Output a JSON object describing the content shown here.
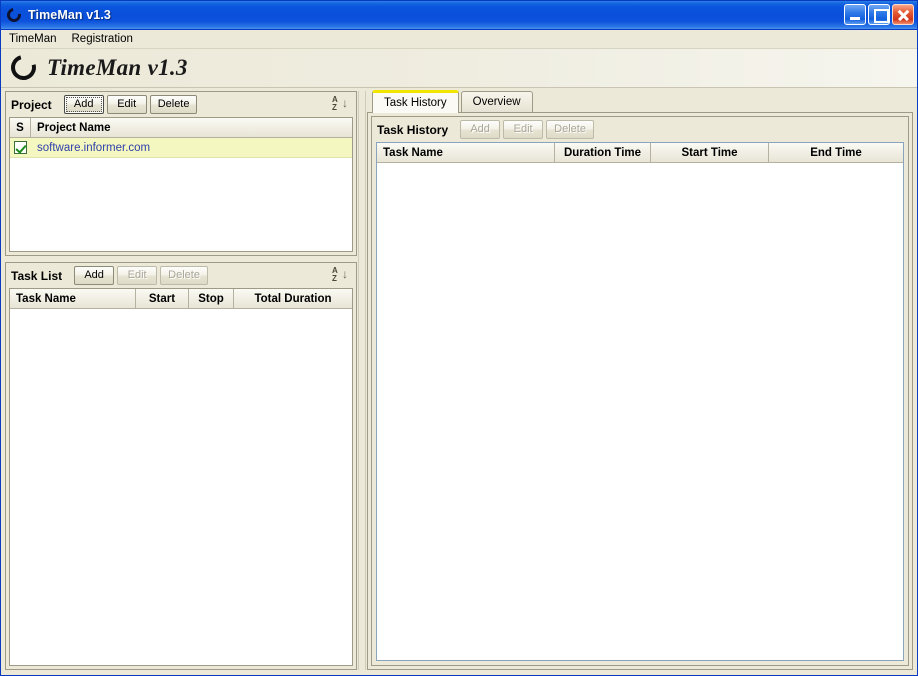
{
  "window": {
    "title": "TimeMan v1.3",
    "icon": "ring-icon",
    "controls": {
      "minimize": "minimize-button",
      "maximize": "maximize-button",
      "close": "close-button"
    }
  },
  "menubar": {
    "items": [
      {
        "label": "TimeMan"
      },
      {
        "label": "Registration"
      }
    ]
  },
  "branding": {
    "logo_icon": "ring-logo",
    "title": "TimeMan v1.3"
  },
  "project_panel": {
    "title": "Project",
    "buttons": [
      {
        "label": "Add",
        "state": "focused"
      },
      {
        "label": "Edit",
        "state": "enabled"
      },
      {
        "label": "Delete",
        "state": "enabled"
      }
    ],
    "sort_icon": "sort-az-descending-icon",
    "columns": [
      {
        "label": "S",
        "align": "center"
      },
      {
        "label": "Project Name",
        "align": "left"
      }
    ],
    "rows": [
      {
        "selected": true,
        "checked": true,
        "name": "software.informer.com"
      }
    ]
  },
  "task_list_panel": {
    "title": "Task List",
    "buttons": [
      {
        "label": "Add",
        "state": "enabled"
      },
      {
        "label": "Edit",
        "state": "disabled"
      },
      {
        "label": "Delete",
        "state": "disabled"
      }
    ],
    "sort_icon": "sort-az-descending-icon",
    "columns": [
      {
        "label": "Task Name",
        "align": "left"
      },
      {
        "label": "Start",
        "align": "center"
      },
      {
        "label": "Stop",
        "align": "center"
      },
      {
        "label": "Total Duration",
        "align": "center"
      }
    ],
    "rows": []
  },
  "tabs": [
    {
      "label": "Task History",
      "active": true
    },
    {
      "label": "Overview",
      "active": false
    }
  ],
  "task_history_panel": {
    "title": "Task History",
    "buttons": [
      {
        "label": "Add",
        "state": "disabled"
      },
      {
        "label": "Edit",
        "state": "disabled"
      },
      {
        "label": "Delete",
        "state": "disabled"
      }
    ],
    "columns": [
      {
        "label": "Task Name",
        "align": "left"
      },
      {
        "label": "Duration Time",
        "align": "center"
      },
      {
        "label": "Start Time",
        "align": "center"
      },
      {
        "label": "End Time",
        "align": "center"
      }
    ],
    "rows": []
  },
  "colors": {
    "titlebar_blue": "#0a4fdb",
    "chrome_beige": "#ece9d8",
    "active_tab_accent": "#f2e600",
    "selected_row": "#f4f7c0",
    "link_text": "#2e3faa",
    "checkbox_check": "#1a8a1a",
    "close_button_red": "#d0361a"
  }
}
